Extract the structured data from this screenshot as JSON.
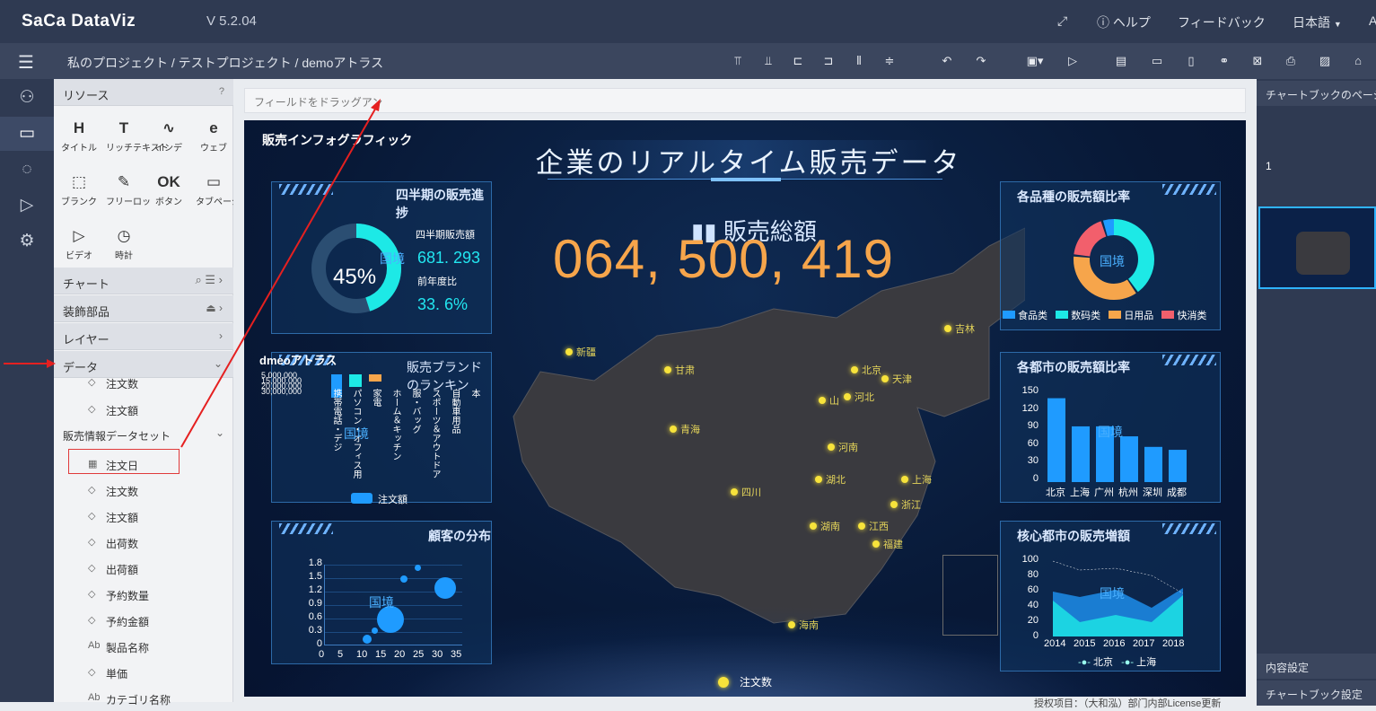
{
  "app": {
    "logo": "SaCa DataViz",
    "version": "V 5.2.04"
  },
  "topright": {
    "help": "ヘルプ",
    "feedback": "フィードバック",
    "lang": "日本語",
    "extra": "A"
  },
  "breadcrumb": "私のプロジェクト / テストプロジェクト / demoアトラス",
  "resources": {
    "title": "リソース",
    "items": [
      {
        "icon": "H",
        "label": "タイトル"
      },
      {
        "icon": "T",
        "label": "リッチテキスト"
      },
      {
        "icon": "∿",
        "label": "インデ"
      },
      {
        "icon": "e",
        "label": "ウェブ"
      },
      {
        "icon": "⬚",
        "label": "ブランク"
      },
      {
        "icon": "✎",
        "label": "フリーロッ"
      },
      {
        "icon": "OK",
        "label": "ボタン"
      },
      {
        "icon": "▭",
        "label": "タブページ"
      },
      {
        "icon": "▷",
        "label": "ビデオ"
      },
      {
        "icon": "◷",
        "label": "時計"
      }
    ]
  },
  "sections": {
    "chart": "チャート",
    "decor": "装飾部品",
    "layer": "レイヤー",
    "data": "データ"
  },
  "fields_top": [
    "注文数",
    "注文額"
  ],
  "dataset": {
    "name": "販売情報データセット",
    "fields": [
      "注文日",
      "注文数",
      "注文額",
      "出荷数",
      "出荷額",
      "予約数量",
      "予約金額",
      "製品名称",
      "単価",
      "カテゴリ名称"
    ]
  },
  "dropzone": "フィールドをドラッグアン",
  "canvas": {
    "corner_title": "販売インフォグラフィック",
    "main_title": "企業のリアルタイム販売データ",
    "total_label": "販売総額",
    "total_value": "064, 500, 419",
    "q_panel": {
      "title": "四半期の販売進捗",
      "percent": "45%",
      "fill": 0.45,
      "sales_label": "四半期販売額",
      "sales_value": "681. 293",
      "yoy_label": "前年度比",
      "yoy_value": "33. 6%",
      "watermark": "国境"
    },
    "brand_panel": {
      "overlay_title": "dmeoアトラス",
      "title": "販売ブランドのランキン",
      "yticks": [
        "5,000,000",
        "15,000,000",
        "20,000,000",
        "30,000,000"
      ],
      "cats": [
        "携帯電話・デジ",
        "パソコン・オフィス用",
        "家電",
        "ホーム＆キッチン",
        "服・バッグ",
        "スポーツ＆アウトドア",
        "自動車用品",
        "本"
      ],
      "legend": "注文額",
      "watermark": "国境"
    },
    "cust_panel": {
      "title": "顧客の分布",
      "yticks": [
        "1.8",
        "1.5",
        "1.2",
        "0.9",
        "0.6",
        "0.3",
        "0"
      ],
      "xticks": [
        "0",
        "5",
        "10",
        "15",
        "20",
        "25",
        "30",
        "35"
      ],
      "watermark": "国境"
    },
    "cat_panel": {
      "title": "各品種の販売額比率",
      "center": "国境",
      "legend": [
        "食品类",
        "数码类",
        "日用品",
        "快消类"
      ]
    },
    "city_panel": {
      "title": "各都市の販売額比率",
      "yticks": [
        "150",
        "120",
        "90",
        "60",
        "30",
        "0"
      ],
      "cities": [
        "北京",
        "上海",
        "广州",
        "杭州",
        "深圳",
        "成都"
      ],
      "values": [
        143,
        95,
        95,
        78,
        60,
        55
      ],
      "watermark": "国境"
    },
    "growth_panel": {
      "title": "核心都市の販売増額",
      "yticks": [
        "100",
        "80",
        "60",
        "40",
        "20",
        "0"
      ],
      "years": [
        "2014",
        "2015",
        "2016",
        "2017",
        "2018"
      ],
      "legend": [
        "北京",
        "上海"
      ],
      "watermark": "国境"
    },
    "map_labels": [
      "新疆",
      "甘肃",
      "青海",
      "四川",
      "北京",
      "天津",
      "山",
      "河北",
      "河南",
      "湖北",
      "上海",
      "浙江",
      "湖南",
      "江西",
      "福建",
      "海南",
      "吉林"
    ],
    "map_legend": "注文数",
    "footer": "授权项目：（大和泓）部门内部License更新"
  },
  "rightpanel": {
    "chapters": "チャートブックのページ",
    "page_no": "1",
    "content": "内容設定",
    "book": "チャートブック設定"
  }
}
